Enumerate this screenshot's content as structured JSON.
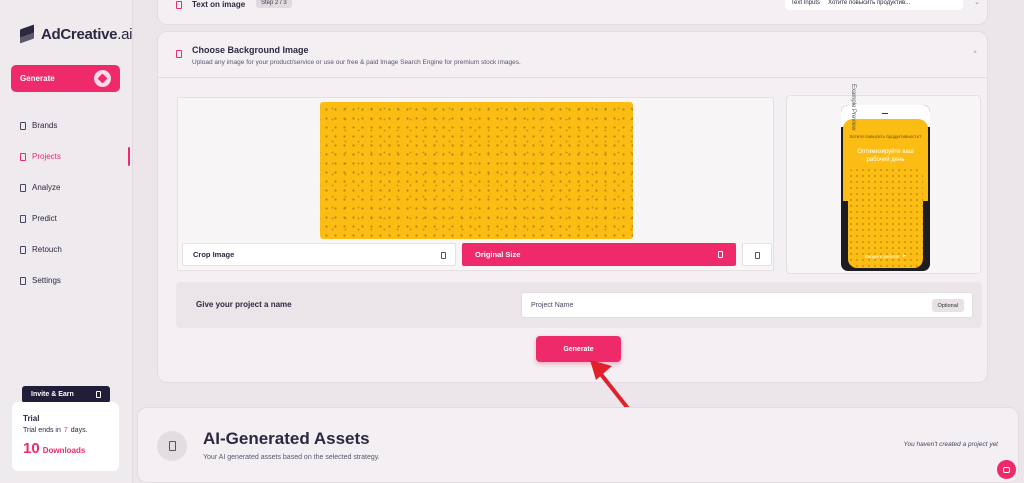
{
  "brand": {
    "name": "AdCreative",
    "suffix": ".ai"
  },
  "sidebar": {
    "generate_label": "Generate",
    "items": [
      {
        "label": "Brands"
      },
      {
        "label": "Projects"
      },
      {
        "label": "Analyze"
      },
      {
        "label": "Predict"
      },
      {
        "label": "Retouch"
      },
      {
        "label": "Settings"
      }
    ],
    "active": "Projects",
    "invite_label": "Invite & Earn",
    "trial": {
      "title": "Trial",
      "line_prefix": "Trial ends in",
      "days": "7",
      "line_suffix": "days.",
      "downloads_count": "10",
      "downloads_label": "Downloads"
    }
  },
  "step_text": {
    "title": "Text on image",
    "step": "Step 2 / 3",
    "tab_label": "Text Inputs",
    "tab_value": "Хотите повысить продуктив..."
  },
  "background": {
    "title": "Choose Background Image",
    "subtitle": "Upload any image for your product/service or use our free & paid Image Search Engine for premium stock images.",
    "crop_label": "Crop Image",
    "original_label": "Original Size",
    "preview_label": "Example Preview",
    "phone": {
      "question": "Хотите повысить продуктивность?",
      "headline": "Оптимизируйте ваш рабочий день",
      "cta": "Входите работа!"
    }
  },
  "project_name": {
    "label": "Give your project a name",
    "placeholder": "Project Name",
    "optional": "Optional"
  },
  "generate_main_label": "Generate",
  "assets": {
    "title": "AI-Generated Assets",
    "subtitle": "Your AI generated assets based on the selected strategy.",
    "empty": "You haven't created a project yet"
  },
  "colors": {
    "accent": "#ee2a6a",
    "dark": "#2d2840",
    "yellow": "#fbbd14",
    "arrow": "#e0202a"
  }
}
